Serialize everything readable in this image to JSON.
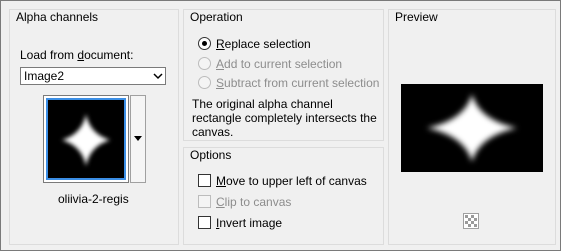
{
  "alpha_channels": {
    "title": "Alpha channels",
    "load_from_label_prefix": "Load from ",
    "load_from_label_underline": "d",
    "load_from_label_suffix": "ocument:",
    "document_select": {
      "value": "Image2"
    },
    "thumbnail_name": "oliivia-2-regis"
  },
  "operation": {
    "title": "Operation",
    "options": [
      {
        "u": "R",
        "rest": "eplace selection",
        "checked": true,
        "enabled": true
      },
      {
        "u": "A",
        "rest": "dd to current selection",
        "checked": false,
        "enabled": false
      },
      {
        "u": "S",
        "rest": "ubtract from current selection",
        "checked": false,
        "enabled": false
      }
    ],
    "description": "The original alpha channel rectangle completely intersects the canvas."
  },
  "options": {
    "title": "Options",
    "checkboxes": [
      {
        "u": "M",
        "rest": "ove to upper left of canvas",
        "checked": false,
        "enabled": true
      },
      {
        "u": "C",
        "rest": "lip to canvas",
        "checked": false,
        "enabled": false
      },
      {
        "u": "I",
        "rest": "nvert image",
        "checked": false,
        "enabled": true
      }
    ]
  },
  "preview": {
    "title": "Preview"
  },
  "colors": {
    "accent_border": "#3b8ee5",
    "disabled_text": "#8d8d8d"
  }
}
